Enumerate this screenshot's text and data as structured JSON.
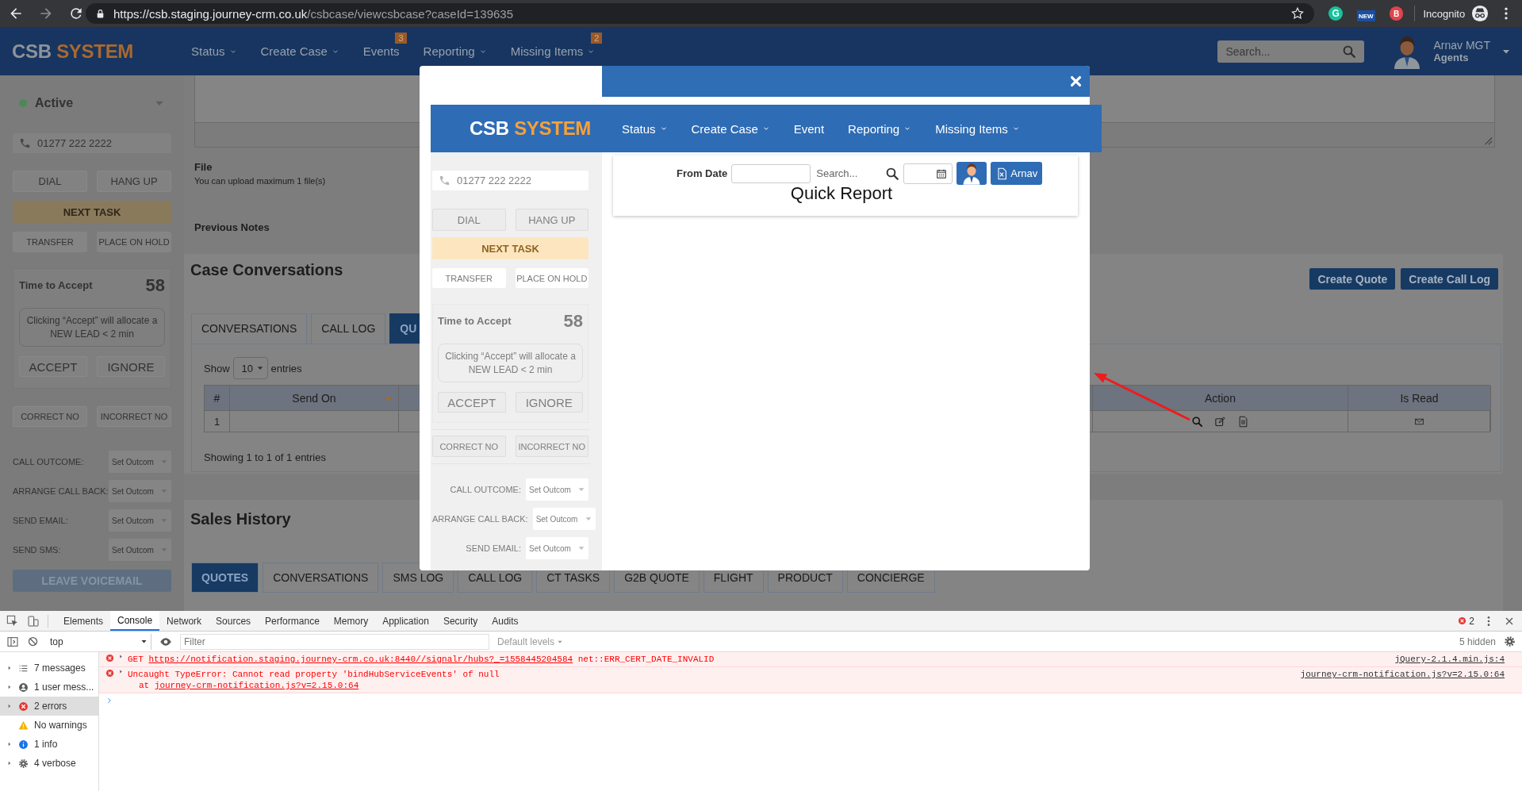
{
  "browser": {
    "url_host": "https://csb.staging.journey-crm.co.uk",
    "url_path": "/csbcase/viewcsbcase?caseId=139635",
    "extensions": [
      "G",
      "NEW",
      "B"
    ],
    "profile": "Incognito"
  },
  "app_header": {
    "brand": "CSB",
    "brand_accent": "SYSTEM",
    "nav": [
      {
        "label": "Status",
        "dropdown": true
      },
      {
        "label": "Create Case",
        "dropdown": true
      },
      {
        "label": "Events",
        "dropdown": false,
        "badge": "3"
      },
      {
        "label": "Reporting",
        "dropdown": true
      },
      {
        "label": "Missing Items",
        "dropdown": true,
        "badge": "2"
      }
    ],
    "search": {
      "placeholder": "Search..."
    },
    "user": {
      "name": "Arnav MGT",
      "role": "Agents"
    }
  },
  "agent_panel": {
    "status": "Active",
    "phone_placeholder": "01277 222 2222",
    "call_buttons": [
      "DIAL",
      "HANG UP"
    ],
    "next_task": "NEXT TASK",
    "hold_buttons": [
      "TRANSFER",
      "PLACE ON HOLD"
    ],
    "accept_label": "Time to Accept",
    "accept_count": "58",
    "accept_notice": "Clicking “Accept” will allocate a NEW LEAD < 2 min",
    "accept_buttons": [
      "ACCEPT",
      "IGNORE"
    ],
    "number_buttons": [
      "CORRECT NO",
      "INCORRECT NO"
    ],
    "outcomes": [
      {
        "label": "CALL OUTCOME:",
        "value": "Set Outcom"
      },
      {
        "label": "ARRANGE CALL BACK:",
        "value": "Set Outcom"
      },
      {
        "label": "SEND EMAIL:",
        "value": "Set Outcom"
      },
      {
        "label": "SEND SMS:",
        "value": "Set Outcom"
      }
    ],
    "voicemail": "LEAVE VOICEMAIL"
  },
  "notes": {
    "file_label": "File",
    "file_hint": "You can upload maximum 1 file(s)",
    "previous_notes": "Previous Notes"
  },
  "case_conversations": {
    "title": "Case Conversations",
    "actions": [
      "Create Quote",
      "Create Call Log"
    ],
    "tabs": [
      {
        "label": "CONVERSATIONS",
        "selected": false
      },
      {
        "label": "CALL LOG",
        "selected": false
      },
      {
        "label": "QU",
        "selected": true
      }
    ],
    "length": {
      "prefix": "Show",
      "value": "10",
      "suffix": "entries"
    },
    "table": {
      "columns": [
        {
          "label": "#",
          "sorted": false
        },
        {
          "label": "Send On",
          "sorted": true
        },
        {
          "label": "Action",
          "sorted": false
        },
        {
          "label": "Is Read",
          "sorted": false
        }
      ],
      "rows": [
        {
          "number": "1"
        }
      ]
    },
    "info": "Showing 1 to 1 of 1 entries"
  },
  "sales_history": {
    "title": "Sales History",
    "tabs": [
      {
        "label": "QUOTES",
        "selected": true
      },
      {
        "label": "CONVERSATIONS",
        "selected": false
      },
      {
        "label": "SMS LOG",
        "selected": false
      },
      {
        "label": "CALL LOG",
        "selected": false
      },
      {
        "label": "CT TASKS",
        "selected": false
      },
      {
        "label": "G2B QUOTE",
        "selected": false
      },
      {
        "label": "FLIGHT",
        "selected": false
      },
      {
        "label": "PRODUCT",
        "selected": false
      },
      {
        "label": "CONCIERGE",
        "selected": false
      }
    ]
  },
  "modal": {
    "header": {
      "brand": "CSB",
      "brand_accent": "SYSTEM",
      "nav": [
        {
          "label": "Status",
          "dropdown": true
        },
        {
          "label": "Create Case",
          "dropdown": true
        },
        {
          "label": "Event",
          "dropdown": false
        },
        {
          "label": "Reporting",
          "dropdown": true
        },
        {
          "label": "Missing Items",
          "dropdown": true
        }
      ]
    },
    "agent_panel": {
      "phone_placeholder": "01277 222 2222",
      "call_buttons": [
        "DIAL",
        "HANG UP"
      ],
      "next_task": "NEXT TASK",
      "hold_buttons": [
        "TRANSFER",
        "PLACE ON HOLD"
      ],
      "accept_label": "Time to Accept",
      "accept_count": "58",
      "accept_notice": "Clicking “Accept” will allocate a NEW LEAD < 2 min",
      "accept_buttons": [
        "ACCEPT",
        "IGNORE"
      ],
      "number_buttons": [
        "CORRECT NO",
        "INCORRECT NO"
      ],
      "outcomes": [
        {
          "label": "CALL OUTCOME:",
          "value": "Set Outcom"
        },
        {
          "label": "ARRANGE CALL BACK:",
          "value": "Set Outcom"
        },
        {
          "label": "SEND EMAIL:",
          "value": "Set Outcom"
        }
      ]
    },
    "report": {
      "from_label": "From Date",
      "search_placeholder": "Search...",
      "export_label": "Arnav",
      "title": "Quick Report"
    }
  },
  "devtools": {
    "tabs": [
      {
        "label": "Elements",
        "selected": false
      },
      {
        "label": "Console",
        "selected": true
      },
      {
        "label": "Network",
        "selected": false
      },
      {
        "label": "Sources",
        "selected": false
      },
      {
        "label": "Performance",
        "selected": false
      },
      {
        "label": "Memory",
        "selected": false
      },
      {
        "label": "Application",
        "selected": false
      },
      {
        "label": "Security",
        "selected": false
      },
      {
        "label": "Audits",
        "selected": false
      }
    ],
    "error_count": "2",
    "context": "top",
    "filter_placeholder": "Filter",
    "levels": "Default levels",
    "hidden_count": "5 hidden",
    "sidebar": [
      {
        "label": "7 messages",
        "kind": "messages",
        "expandable": true,
        "selected": false
      },
      {
        "label": "1 user mess...",
        "kind": "user",
        "expandable": true,
        "selected": false
      },
      {
        "label": "2 errors",
        "kind": "errors",
        "expandable": true,
        "selected": true
      },
      {
        "label": "No warnings",
        "kind": "warnings",
        "expandable": false,
        "selected": false
      },
      {
        "label": "1 info",
        "kind": "info",
        "expandable": true,
        "selected": false
      },
      {
        "label": "4 verbose",
        "kind": "verbose",
        "expandable": true,
        "selected": false
      }
    ],
    "messages": [
      {
        "kind": "error",
        "method": "GET",
        "url": "https://notification.staging.journey-crm.co.uk:8440//signalr/hubs?_=1558445204584",
        "text": "net::ERR_CERT_DATE_INVALID",
        "source": "jQuery-2.1.4.min.js:4"
      },
      {
        "kind": "error",
        "text": "Uncaught TypeError: Cannot read property 'bindHubServiceEvents' of null",
        "trace_prefix": "at",
        "trace": "journey-crm-notification.js?v=2.15.0:64",
        "source": "journey-crm-notification.js?v=2.15.0:64"
      }
    ]
  }
}
